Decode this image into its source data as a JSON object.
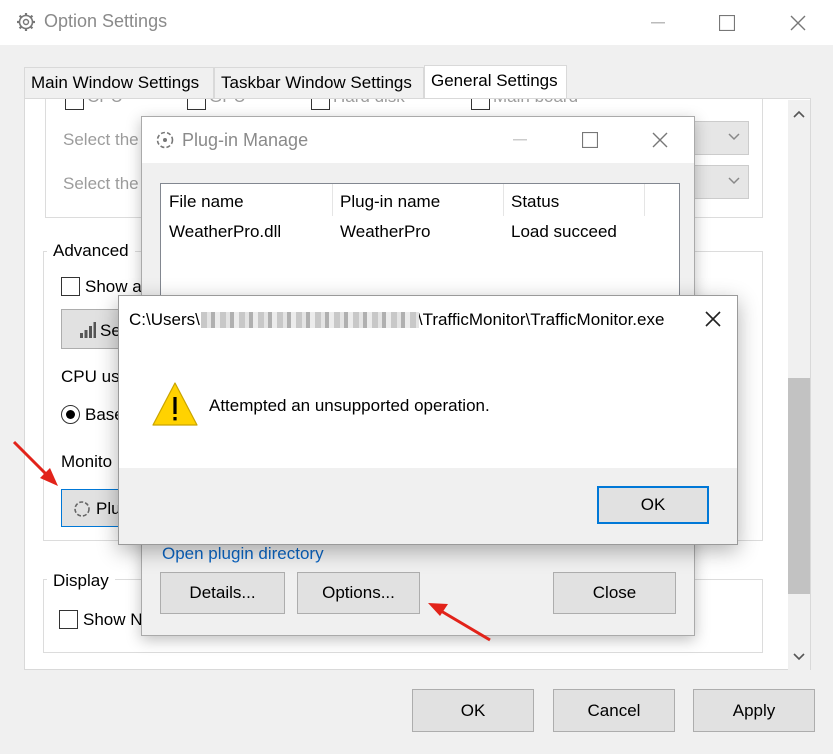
{
  "main_window": {
    "title": "Option Settings",
    "tabs": [
      {
        "label": "Main Window Settings"
      },
      {
        "label": "Taskbar Window Settings"
      },
      {
        "label": "General Settings"
      }
    ],
    "partial_checkboxes": [
      "CPU",
      "GPU",
      "Hard disk",
      "Main board"
    ],
    "select_label_1": "Select the",
    "select_label_2": "Select the",
    "advanced": {
      "label": "Advanced",
      "show_checkbox": "Show a",
      "settings_button": "Se",
      "cpu_usage_label": "CPU usa",
      "radio_label": "Base",
      "monitor_label": "Monito",
      "plugin_button": "Plu"
    },
    "display": {
      "label": "Display",
      "show_checkbox": "Show N"
    },
    "buttons": {
      "ok": "OK",
      "cancel": "Cancel",
      "apply": "Apply"
    }
  },
  "plugin_dialog": {
    "title": "Plug-in Manage",
    "columns": [
      "File name",
      "Plug-in name",
      "Status"
    ],
    "rows": [
      {
        "file": "WeatherPro.dll",
        "name": "WeatherPro",
        "status": "Load succeed"
      }
    ],
    "link": "Open plugin directory",
    "buttons": {
      "details": "Details...",
      "options": "Options...",
      "close": "Close"
    }
  },
  "error_dialog": {
    "path_prefix": "C:\\Users\\",
    "path_suffix": "\\TrafficMonitor\\TrafficMonitor.exe",
    "message": "Attempted an unsupported operation.",
    "ok": "OK",
    "icon": "warning-icon"
  },
  "colors": {
    "accent": "#0067c0",
    "link": "#0a64c2",
    "annotation_arrow": "#e2231a",
    "warning_yellow": "#ffd200"
  }
}
